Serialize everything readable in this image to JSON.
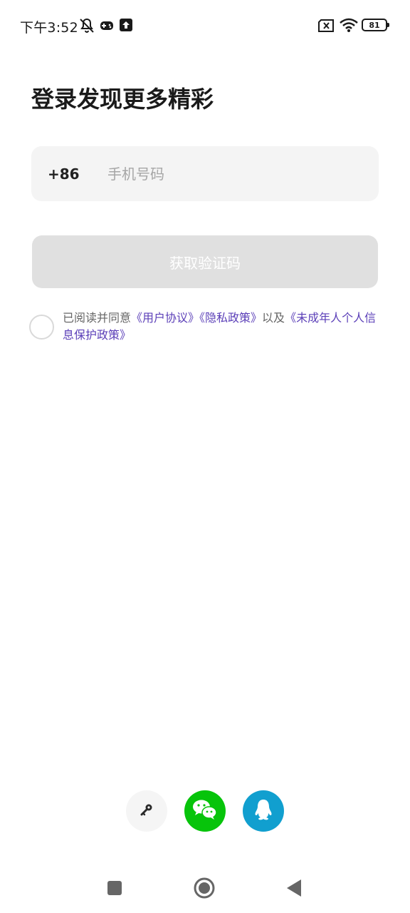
{
  "status_bar": {
    "time": "下午3:52",
    "battery_level": "81",
    "icons": [
      "muted-bell-icon",
      "game-controller-icon",
      "upload-icon",
      "sim-card-x-icon",
      "wifi-icon",
      "battery-icon"
    ]
  },
  "header": {
    "title": "登录发现更多精彩"
  },
  "phone_form": {
    "country_code": "+86",
    "phone_placeholder": "手机号码",
    "get_code_label": "获取验证码"
  },
  "agreement": {
    "prefix": "已阅读并同意",
    "user_agreement": "《用户协议》",
    "privacy_policy": "《隐私政策》",
    "and": "以及",
    "minor_policy": "《未成年人个人信息保护政策》",
    "checked": false
  },
  "third_party_login": {
    "icons": [
      "key-icon",
      "wechat-icon",
      "qq-icon"
    ],
    "colors": {
      "key_bg": "#f5f5f5",
      "wechat_bg": "#07c40b",
      "qq_bg": "#119fcf"
    }
  },
  "nav_bar": {
    "icons": [
      "recents-square-icon",
      "home-circle-icon",
      "back-triangle-icon"
    ]
  },
  "colors": {
    "link": "#5b3fb8",
    "button_disabled": "#e0e0e0",
    "input_bg": "#f4f4f4"
  }
}
